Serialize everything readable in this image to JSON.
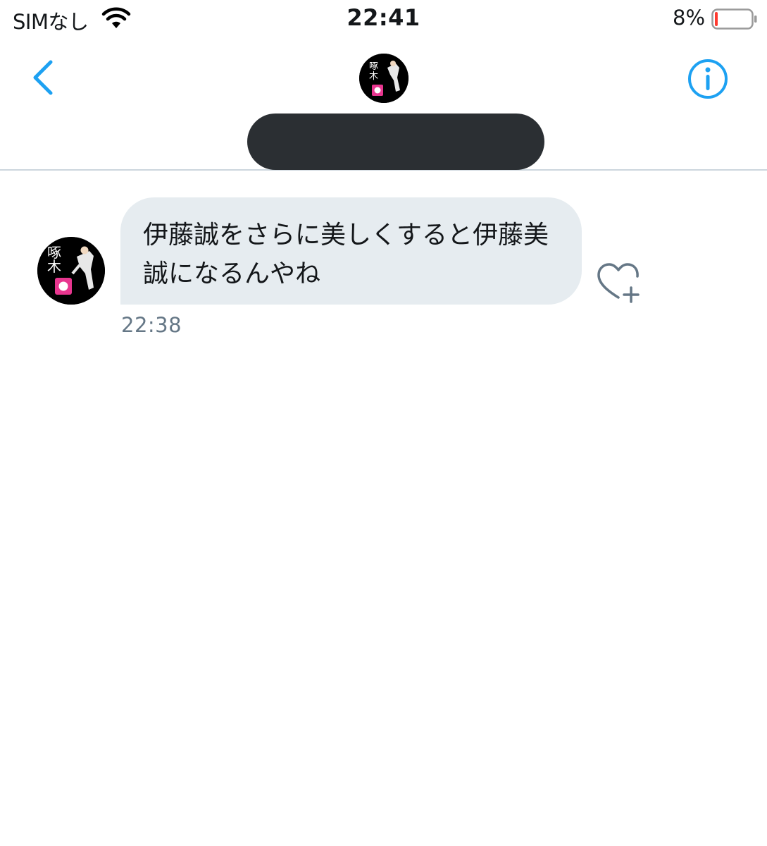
{
  "status_bar": {
    "carrier": "SIMなし",
    "time": "22:41",
    "battery_percent": "8%",
    "battery_level": 0.08,
    "battery_color": "#ff3b30",
    "wifi_icon": "wifi-icon"
  },
  "header": {
    "back_icon": "chevron-left-icon",
    "info_icon": "info-circle-icon",
    "accent_color": "#1da1f2",
    "avatar_text": "啄木"
  },
  "messages": [
    {
      "text": "伊藤誠をさらに美しくすると伊藤美誠になるんやね",
      "time": "22:38",
      "avatar_text": "啄木",
      "reaction_icon": "heart-add-icon"
    }
  ]
}
